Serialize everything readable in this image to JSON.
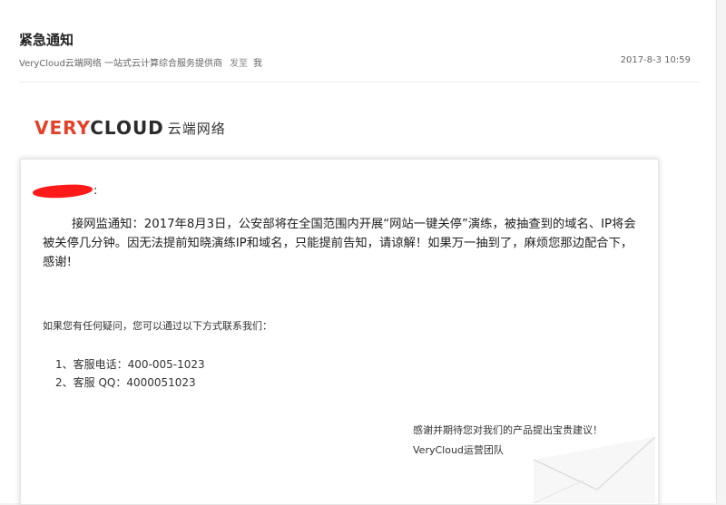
{
  "email": {
    "subject": "紧急通知",
    "sender": "VeryCloud云端网络 一站式云计算综合服务提供商",
    "sent_to_label": "发至",
    "recipient": "我",
    "date": "2017-8-3 10:59"
  },
  "logo": {
    "brand_prefix": "V",
    "brand_middle": "ERY",
    "brand_rest": "CLOUD",
    "brand_cn": "云端网络"
  },
  "body": {
    "greeting_colon": ":",
    "paragraph": "接网监通知：2017年8月3日，公安部将在全国范围内开展“网站一键关停”演练，被抽查到的域名、IP将会被关停几分钟。因无法提前知晓演练IP和域名，只能提前告知，请谅解！如果万一抽到了，麻烦您那边配合下，感谢!",
    "contact_intro": "如果您有任何疑问，您可以通过以下方式联系我们：",
    "contacts": [
      "1、客服电话：400-005-1023",
      "2、客服 QQ：4000051023"
    ],
    "closing": "感谢并期待您对我们的产品提出宝贵建议！",
    "signature": "VeryCloud运营团队"
  },
  "colors": {
    "brand_red": "#e3412a",
    "redaction": "#ff1a1a"
  }
}
